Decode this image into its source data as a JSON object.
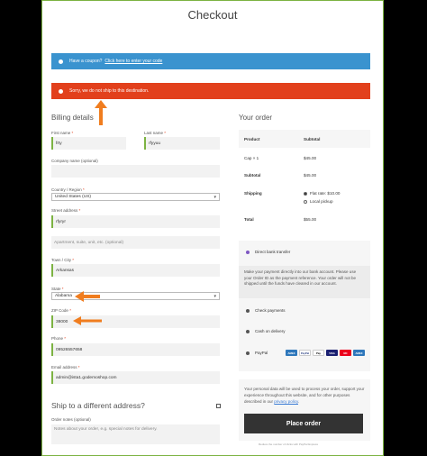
{
  "page": {
    "title": "Checkout"
  },
  "notices": {
    "coupon_text": "Have a coupon?",
    "coupon_link": "Click here to enter your code",
    "error_text": "Sorry, we do not ship to this destination."
  },
  "billing": {
    "heading": "Billing details",
    "first_name": {
      "label": "First name",
      "value": "frty"
    },
    "last_name": {
      "label": "Last name",
      "value": "rfyyuu"
    },
    "company": {
      "label": "Company name (optional)",
      "value": ""
    },
    "country": {
      "label": "Country / Region",
      "value": "United States (US)"
    },
    "street": {
      "label": "Street address",
      "value": "rfyryr",
      "placeholder2": "Apartment, suite, unit, etc. (optional)"
    },
    "city": {
      "label": "Town / City",
      "value": "Arkansas"
    },
    "state": {
      "label": "State",
      "value": "Alabama"
    },
    "zip": {
      "label": "ZIP Code",
      "value": "38000"
    },
    "phone": {
      "label": "Phone",
      "value": "09526557658"
    },
    "email": {
      "label": "Email address",
      "value": "admin@ista1.godemoshop.com"
    },
    "required_mark": "*"
  },
  "shipping": {
    "heading": "Ship to a different address?",
    "notes_label": "Order notes (optional)",
    "notes_placeholder": "Notes about your order, e.g. special notes for delivery."
  },
  "order": {
    "heading": "Your order",
    "col_product": "Product",
    "col_subtotal": "Subtotal",
    "item_name": "Cap",
    "item_qty": "× 1",
    "item_price": "$45.00",
    "subtotal_label": "Subtotal",
    "subtotal_value": "$45.00",
    "shipping_label": "Shipping",
    "ship_option1": "Flat rate: $10.00",
    "ship_option2": "Local pickup",
    "total_label": "Total",
    "total_value": "$55.00"
  },
  "payment": {
    "bank": "Direct bank transfer",
    "bank_desc": "Make your payment directly into our bank account. Please use your Order ID as the payment reference. Your order will not be shipped until the funds have cleared in our account.",
    "check": "Check payments",
    "cod": "Cash on delivery",
    "paypal": "PayPal",
    "cards": [
      "AMEX",
      "PayPal",
      "Pay",
      "VISA",
      "MC",
      "AMEX"
    ]
  },
  "privacy": {
    "text": "Your personal data will be used to process your order, support your experience throughout this website, and for other purposes described in our",
    "link": "privacy policy",
    "period": "."
  },
  "place_order": "Place order",
  "footer": "Reduce the number of clicks with PayPal Express"
}
